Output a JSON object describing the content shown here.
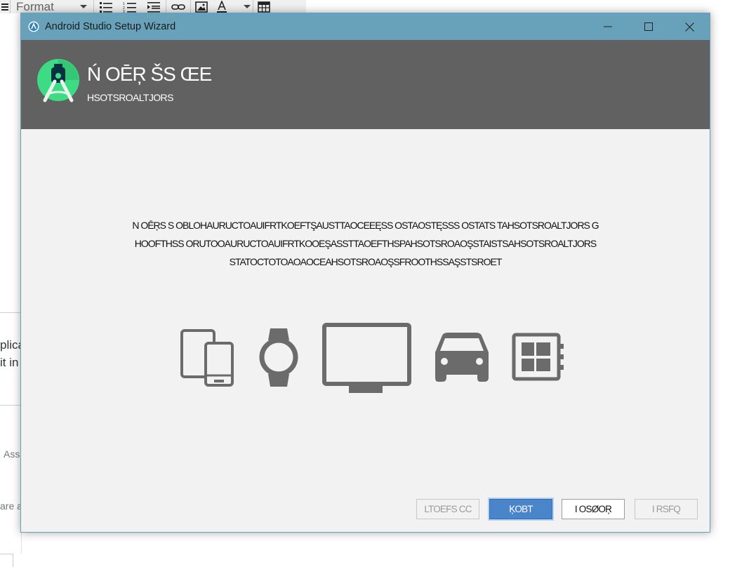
{
  "background_app": {
    "toolbar": {
      "format_label": "Format"
    },
    "side_text": {
      "line1": "plica",
      "line2": "it in",
      "line3": "Ass",
      "line4": "are a"
    }
  },
  "window": {
    "title": "Android Studio Setup Wizard",
    "controls": {
      "minimize": "—",
      "maximize": "☐",
      "close": "✕"
    }
  },
  "header": {
    "title": "Ń OĒŖ ŠS ŒE",
    "subtitle": "HSOTSROALTJORS"
  },
  "description": {
    "line1": "N OĒŖS S OBLOHAURUCTOAUIFRTKOEFTŞAUSTTAOCEEĘSS OSTAOSTĘSSS OSTATS TAHSOTSROALTJORS G",
    "line2": "HOOFTHSS ORUTOOAURUCTOAUIFRTKOOEŞASSTTAOEFTHSPAHSOTSROAOŞSTAISTSAHSOTSROALTJORS",
    "line3": "STATOCTOTOAOAOCEAHSOTSROAOŞSFROOTHSSAŞSTSROET"
  },
  "devices": [
    "phone-tablet-icon",
    "watch-icon",
    "tv-icon",
    "car-icon",
    "things-icon"
  ],
  "buttons": {
    "previous": "LTOEFS CC",
    "next": "ĶOBT",
    "cancel": "I OSØOŖ",
    "finish": "I RSFQ"
  },
  "colors": {
    "titlebar": "#67a2ba",
    "header": "#616161",
    "primary_button": "#4b85c9",
    "logo_green": "#3ddc84",
    "device_gray": "#6b6b6b"
  }
}
